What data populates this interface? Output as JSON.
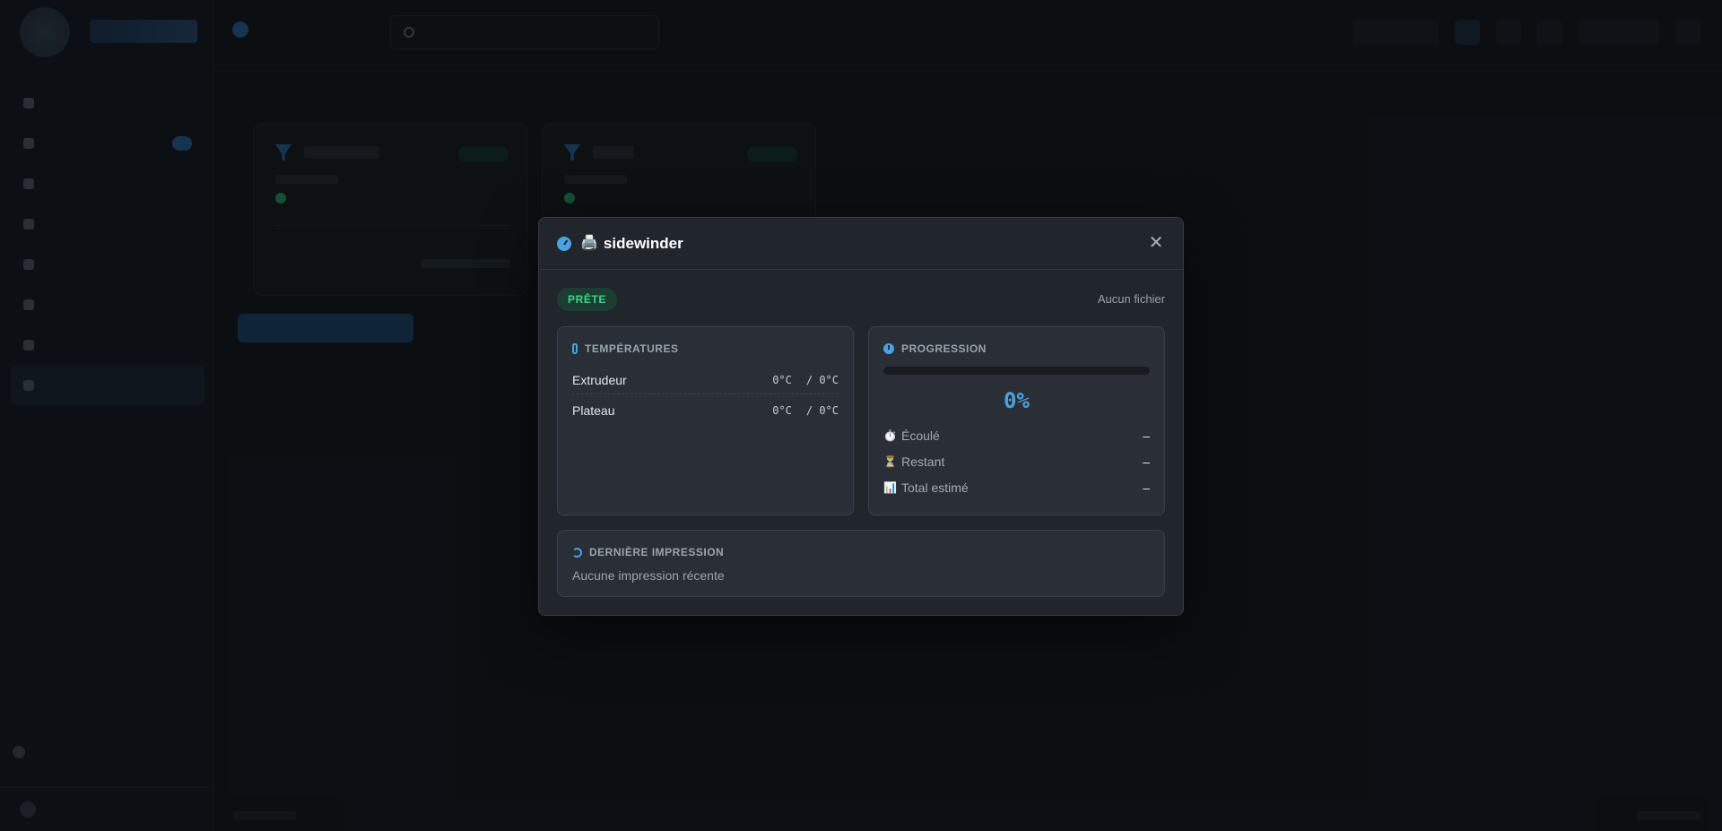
{
  "app": {
    "sidebar_items": [
      "",
      "",
      "",
      "",
      "",
      "",
      "",
      ""
    ],
    "page_title": "",
    "search_placeholder": ""
  },
  "modal": {
    "title": "sidewinder",
    "printer_glyph": "🖨️",
    "close_glyph": "✕",
    "status_pill": "PRÊTE",
    "file_label": "Aucun fichier",
    "temperatures": {
      "title": "TEMPÉRATURES",
      "rows": [
        {
          "label": "Extrudeur",
          "current": "0°C",
          "target": "/ 0°C"
        },
        {
          "label": "Plateau",
          "current": "0°C",
          "target": "/ 0°C"
        }
      ]
    },
    "progression": {
      "title": "PROGRESSION",
      "progress_fraction": 0,
      "percent_text": "0%",
      "stats": [
        {
          "icon": "⏱️",
          "label": "Écoulé",
          "value": "–"
        },
        {
          "icon": "⏳",
          "label": "Restant",
          "value": "–"
        },
        {
          "icon": "📊",
          "label": "Total estimé",
          "value": "–"
        }
      ]
    },
    "last_print": {
      "title": "DERNIÈRE IMPRESSION",
      "text": "Aucune impression récente"
    }
  },
  "colors": {
    "accent": "#4aa3df",
    "ready_green": "#3ed48d"
  }
}
